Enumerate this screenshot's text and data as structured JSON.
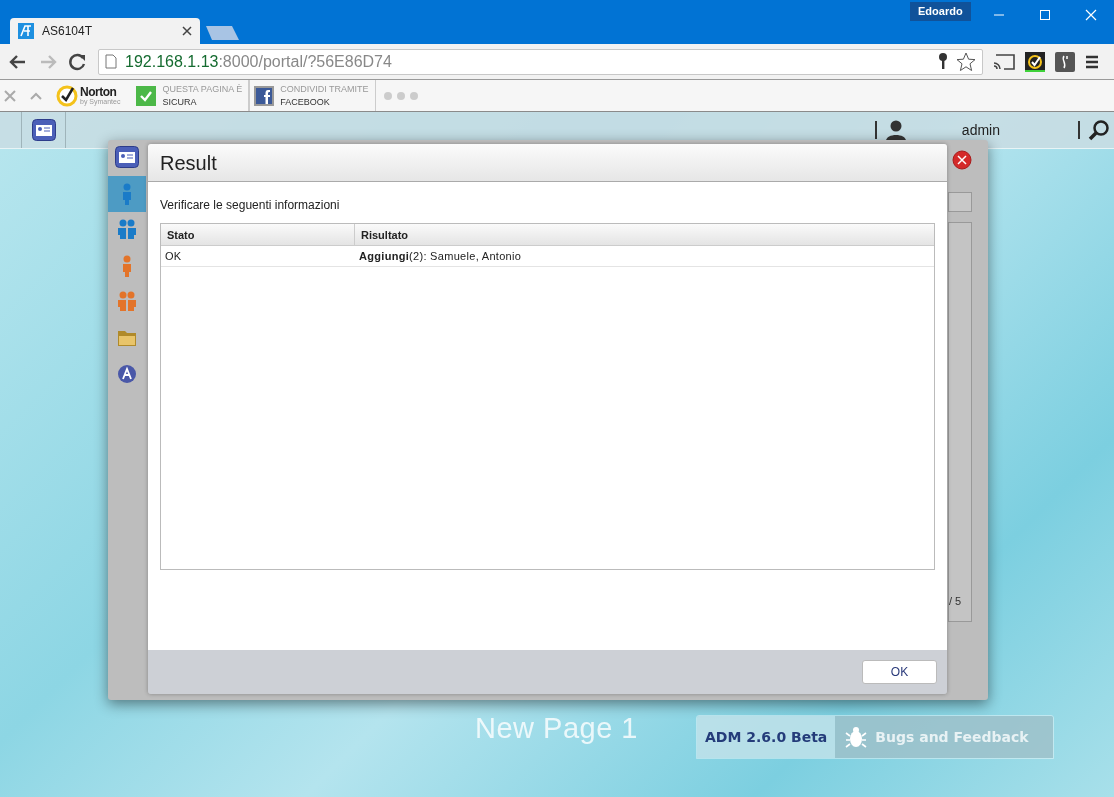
{
  "browser": {
    "tabs": [
      {
        "title": "AS6104T",
        "selected": true
      }
    ],
    "profile": "Edoardo",
    "address": {
      "host": "192.168.1.13",
      "rest": ":8000/portal/?56E86D74"
    }
  },
  "extensions_bar": {
    "norton": {
      "name": "Norton",
      "by": "by Symantec"
    },
    "items": [
      {
        "kind": "check",
        "line1": "QUESTA PAGINA È",
        "line2": "SICURA"
      },
      {
        "kind": "facebook",
        "line1": "CONDIVIDI TRAMITE",
        "line2": "FACEBOOK"
      }
    ]
  },
  "app_header": {
    "user": "admin"
  },
  "sidebar": {
    "items": [
      {
        "kind": "user",
        "selected": true
      },
      {
        "kind": "group",
        "selected": false
      },
      {
        "kind": "local-user",
        "selected": false
      },
      {
        "kind": "local-group",
        "selected": false
      },
      {
        "kind": "folder",
        "selected": false
      },
      {
        "kind": "ad",
        "selected": false
      }
    ]
  },
  "dialog": {
    "title": "Result",
    "message": "Verificare le seguenti informazioni",
    "table": {
      "columns": [
        "Stato",
        "Risultato"
      ],
      "rows": [
        [
          "OK",
          "**Aggiungi**(2): Samuele, Antonio"
        ]
      ]
    },
    "buttons": [
      "OK"
    ]
  },
  "background_panel": {
    "pager": "/ 5"
  },
  "page_title": "New Page 1",
  "footer_bar": {
    "version": "ADM 2.6.0 Beta",
    "feedback": "Bugs and Feedback"
  }
}
